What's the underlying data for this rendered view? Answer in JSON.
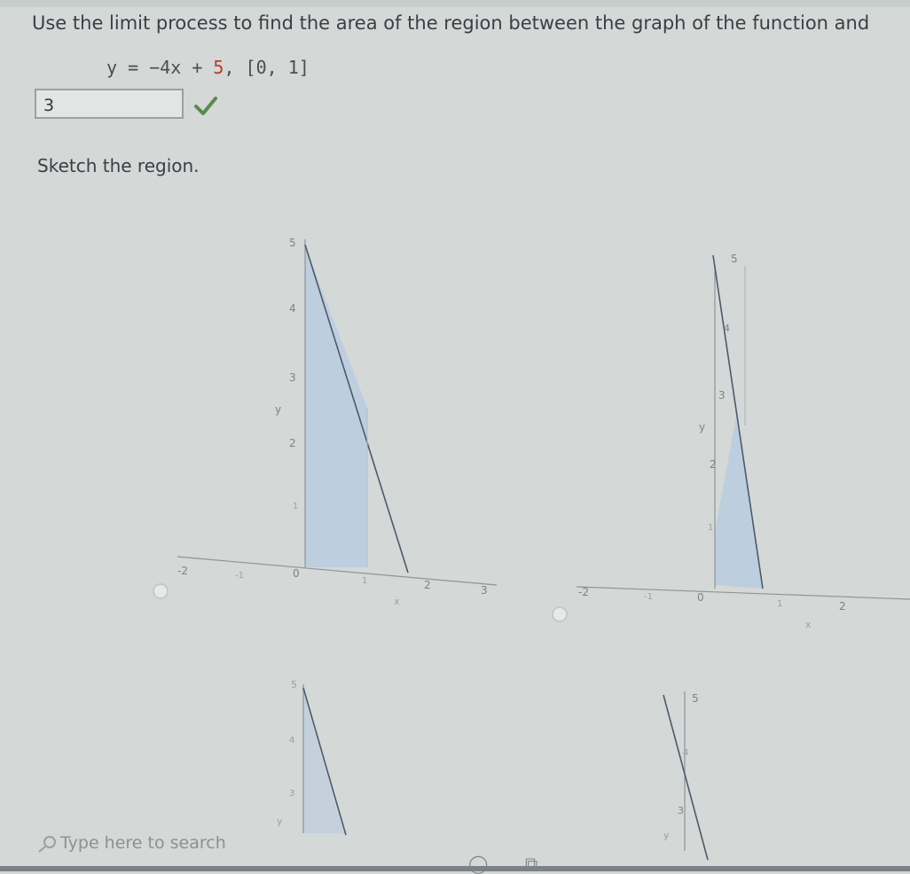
{
  "question": {
    "text": "Use the limit process to find the area of the region between the graph of the function and",
    "equation_prefix": "y = −4x + ",
    "equation_const": "5",
    "equation_interval": ", [0, 1]"
  },
  "answer": {
    "value": "3",
    "status": "correct",
    "check_color": "#5a8a4e"
  },
  "sketch_label": "Sketch the region.",
  "options": [
    {
      "id": "a",
      "selected": false
    },
    {
      "id": "b",
      "selected": false
    }
  ],
  "graphs": {
    "g1": {
      "y_ticks": [
        "5",
        "4",
        "3",
        "2",
        "1"
      ],
      "x_ticks": [
        "-2",
        "-1",
        "0",
        "1",
        "2",
        "3"
      ],
      "xlabel": "x",
      "ylabel": "y"
    },
    "g2": {
      "y_ticks": [
        "5",
        "4",
        "3",
        "2",
        "1"
      ],
      "x_ticks": [
        "-2",
        "-1",
        "0",
        "1",
        "2"
      ],
      "xlabel": "x",
      "ylabel": "y"
    },
    "g3": {
      "y_ticks": [
        "5",
        "4",
        "3"
      ],
      "ylabel": "y"
    },
    "g4": {
      "y_ticks": [
        "5",
        "4",
        "3"
      ],
      "ylabel": "y"
    }
  },
  "taskbar": {
    "search_placeholder": "Type here to search"
  },
  "colors": {
    "region_fill": "#b9cde0",
    "line": "#4d5a6a",
    "axis": "#8e9499",
    "label": "#7c8288"
  }
}
